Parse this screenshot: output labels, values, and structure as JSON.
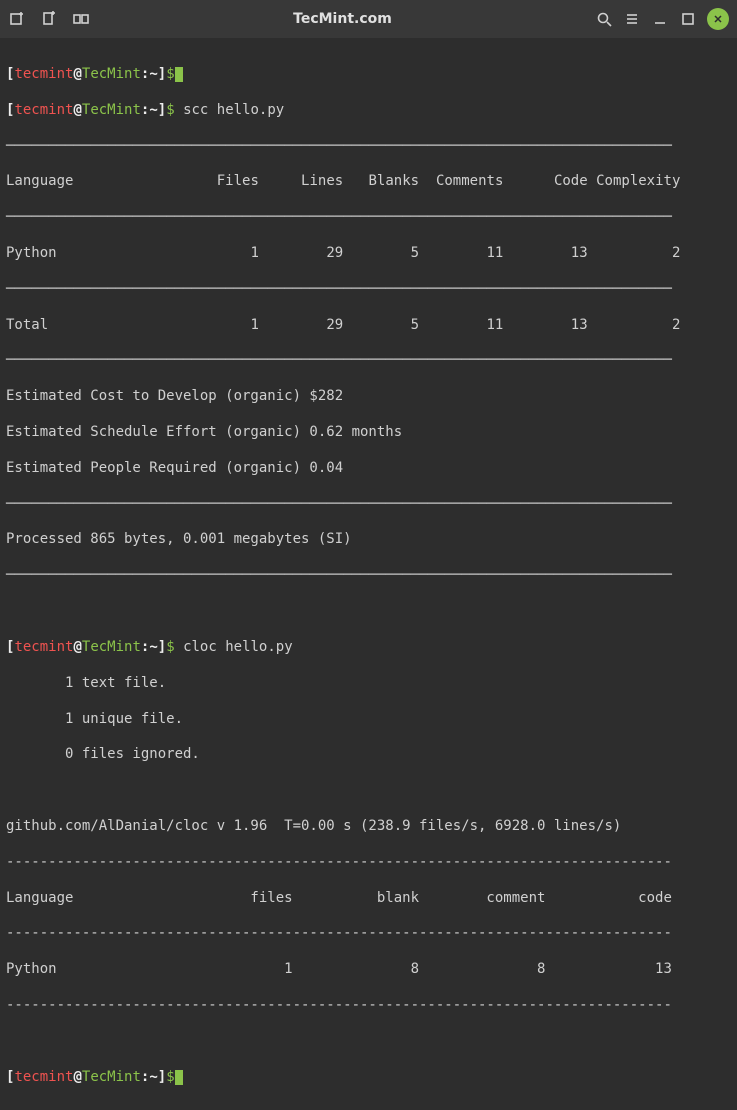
{
  "titlebar": {
    "title": "TecMint.com"
  },
  "prompt": {
    "user": "tecmint",
    "at": "@",
    "host": "TecMint",
    "path": ":~",
    "close": "]",
    "dollar": "$"
  },
  "cmd1": " scc hello.py",
  "scc": {
    "header": {
      "lang": "Language",
      "files": "Files",
      "lines": "Lines",
      "blanks": "Blanks",
      "comments": "Comments",
      "code": "Code",
      "complexity": "Complexity"
    },
    "row_python": {
      "lang": "Python",
      "files": "1",
      "lines": "29",
      "blanks": "5",
      "comments": "11",
      "code": "13",
      "complexity": "2"
    },
    "row_total": {
      "lang": "Total",
      "files": "1",
      "lines": "29",
      "blanks": "5",
      "comments": "11",
      "code": "13",
      "complexity": "2"
    },
    "est_cost": "Estimated Cost to Develop (organic) $282",
    "est_sched": "Estimated Schedule Effort (organic) 0.62 months",
    "est_people": "Estimated People Required (organic) 0.04",
    "processed": "Processed 865 bytes, 0.001 megabytes (SI)"
  },
  "cmd2": " cloc hello.py",
  "cloc": {
    "line1": "       1 text file.",
    "line2": "       1 unique file.",
    "line3": "       0 files ignored.",
    "banner": "github.com/AlDanial/cloc v 1.96  T=0.00 s (238.9 files/s, 6928.0 lines/s)",
    "dash": "-------------------------------------------------------------------------------",
    "header": "Language                     files          blank        comment           code",
    "row": "Python                           1              8              8             13"
  }
}
